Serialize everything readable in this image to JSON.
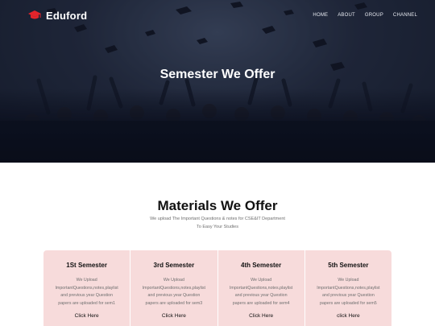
{
  "brand": {
    "name": "Eduford",
    "logo_icon": "graduation-cap-icon",
    "logo_color": "#e3242b"
  },
  "nav": {
    "items": [
      "HOME",
      "ABOUT",
      "GROUP",
      "CHANNEL"
    ]
  },
  "hero": {
    "title": "Semester We Offer"
  },
  "materials": {
    "title": "Materials We Offer",
    "subtitle_line1": "We upload The Important Questions & notes for CSE&IT Department",
    "subtitle_line2": "To Easy Your Studies",
    "card_color": "#f7dbdb",
    "cards": [
      {
        "title": "1St Semester",
        "desc_1": "We Upload",
        "desc_2": "ImportantQuestions,notes,playlist",
        "desc_3": "and previous year Question",
        "desc_4": "papers are uploaded for sem1",
        "link": "Click Here"
      },
      {
        "title": "3rd Semester",
        "desc_1": "We Upload",
        "desc_2": "ImportantQuestions,notes,playlist",
        "desc_3": "and previous year Question",
        "desc_4": "papers are uploaded for sem3",
        "link": "Click Here"
      },
      {
        "title": "4th Semester",
        "desc_1": "We Upload",
        "desc_2": "ImportantQuestions,notes,playlist",
        "desc_3": "and previous year Question",
        "desc_4": "papers are uploaded for sem4",
        "link": "Click Here"
      },
      {
        "title": "5th Semester",
        "desc_1": "We Upload",
        "desc_2": "ImportantQuestions,notes,playlist",
        "desc_3": "and previous year Question",
        "desc_4": "papers are uploaded for sem5",
        "link": "click Here"
      }
    ]
  }
}
